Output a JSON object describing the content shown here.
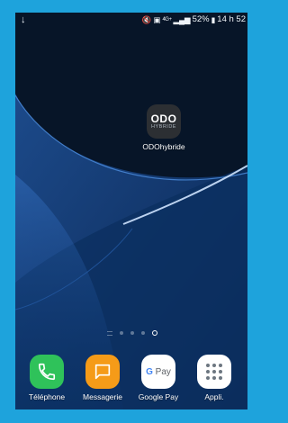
{
  "status_bar": {
    "download_icon": "download-arrow-icon",
    "network_tag": "4G+",
    "battery": "52%",
    "time": "14 h 52"
  },
  "home_app": {
    "logo_text": "ODO",
    "logo_subtext": "HYBRIDE",
    "label": "ODOhybride"
  },
  "dock": [
    {
      "label": "Téléphone",
      "icon": "phone-icon"
    },
    {
      "label": "Messagerie",
      "icon": "chat-bubble-icon"
    },
    {
      "label": "Google Pay",
      "icon": "google-pay-icon",
      "icon_text": "Pay"
    },
    {
      "label": "Appli.",
      "icon": "app-drawer-icon"
    }
  ],
  "colors": {
    "frame": "#1ea3dc",
    "phone": "#2fc25a",
    "messages": "#f59b18"
  }
}
